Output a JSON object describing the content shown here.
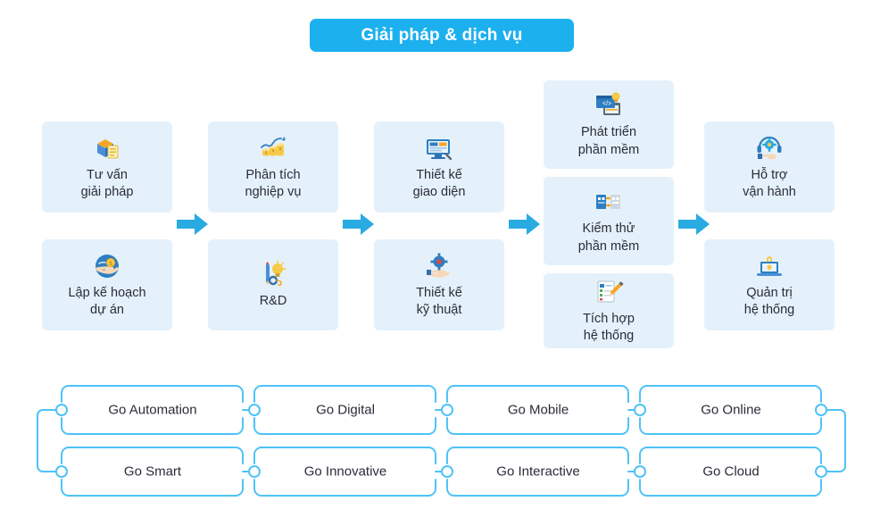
{
  "header": {
    "title": "Giải pháp & dịch vụ",
    "banner_color": "#1cb0ef",
    "title_color": "#ffffff"
  },
  "theme": {
    "box_fill": "#e4f1fb",
    "accent": "#29abe2",
    "arrow_color": "#29abe2",
    "connector_color": "#4ec3f7",
    "text_color": "#2b2b38",
    "page_background": "#ffffff"
  },
  "flow": {
    "columns": [
      {
        "index": 1,
        "items": [
          {
            "label": "Tư vấn\ngiải pháp",
            "icon": "box-checklist-icon"
          },
          {
            "label": "Lập kế hoạch\ndự án",
            "icon": "hand-coin-icon"
          }
        ]
      },
      {
        "index": 2,
        "items": [
          {
            "label": "Phân tích\nnghiệp vụ",
            "icon": "growth-chart-coins-icon"
          },
          {
            "label": "R&D",
            "icon": "pencil-lightbulb-gear-icon"
          }
        ]
      },
      {
        "index": 3,
        "items": [
          {
            "label": "Thiết kế\ngiao diện",
            "icon": "monitor-design-icon"
          },
          {
            "label": "Thiết kế\nkỹ thuật",
            "icon": "hand-gear-icon"
          }
        ]
      },
      {
        "index": 4,
        "items": [
          {
            "label": "Phát triển\nphần mềm",
            "icon": "code-window-icon"
          },
          {
            "label": "Kiểm thử\nphần mềm",
            "icon": "test-transfer-icon"
          },
          {
            "label": "Tích hợp\nhệ thống",
            "icon": "document-pencil-icon"
          }
        ]
      },
      {
        "index": 5,
        "items": [
          {
            "label": "Hỗ trợ\nvận hành",
            "icon": "headset-support-icon"
          },
          {
            "label": "Quản trị\nhệ thống",
            "icon": "laptop-admin-icon"
          }
        ]
      }
    ],
    "arrows": [
      {
        "name": "arrow-1-to-2"
      },
      {
        "name": "arrow-2-to-3"
      },
      {
        "name": "arrow-3-to-4"
      },
      {
        "name": "arrow-4-to-5"
      }
    ]
  },
  "go_network": {
    "rows": [
      {
        "row": 1,
        "items": [
          "Go Automation",
          "Go Digital",
          "Go Mobile",
          "Go Online"
        ]
      },
      {
        "row": 2,
        "items": [
          "Go Smart",
          "Go Innovative",
          "Go Interactive",
          "Go Cloud"
        ]
      }
    ]
  }
}
